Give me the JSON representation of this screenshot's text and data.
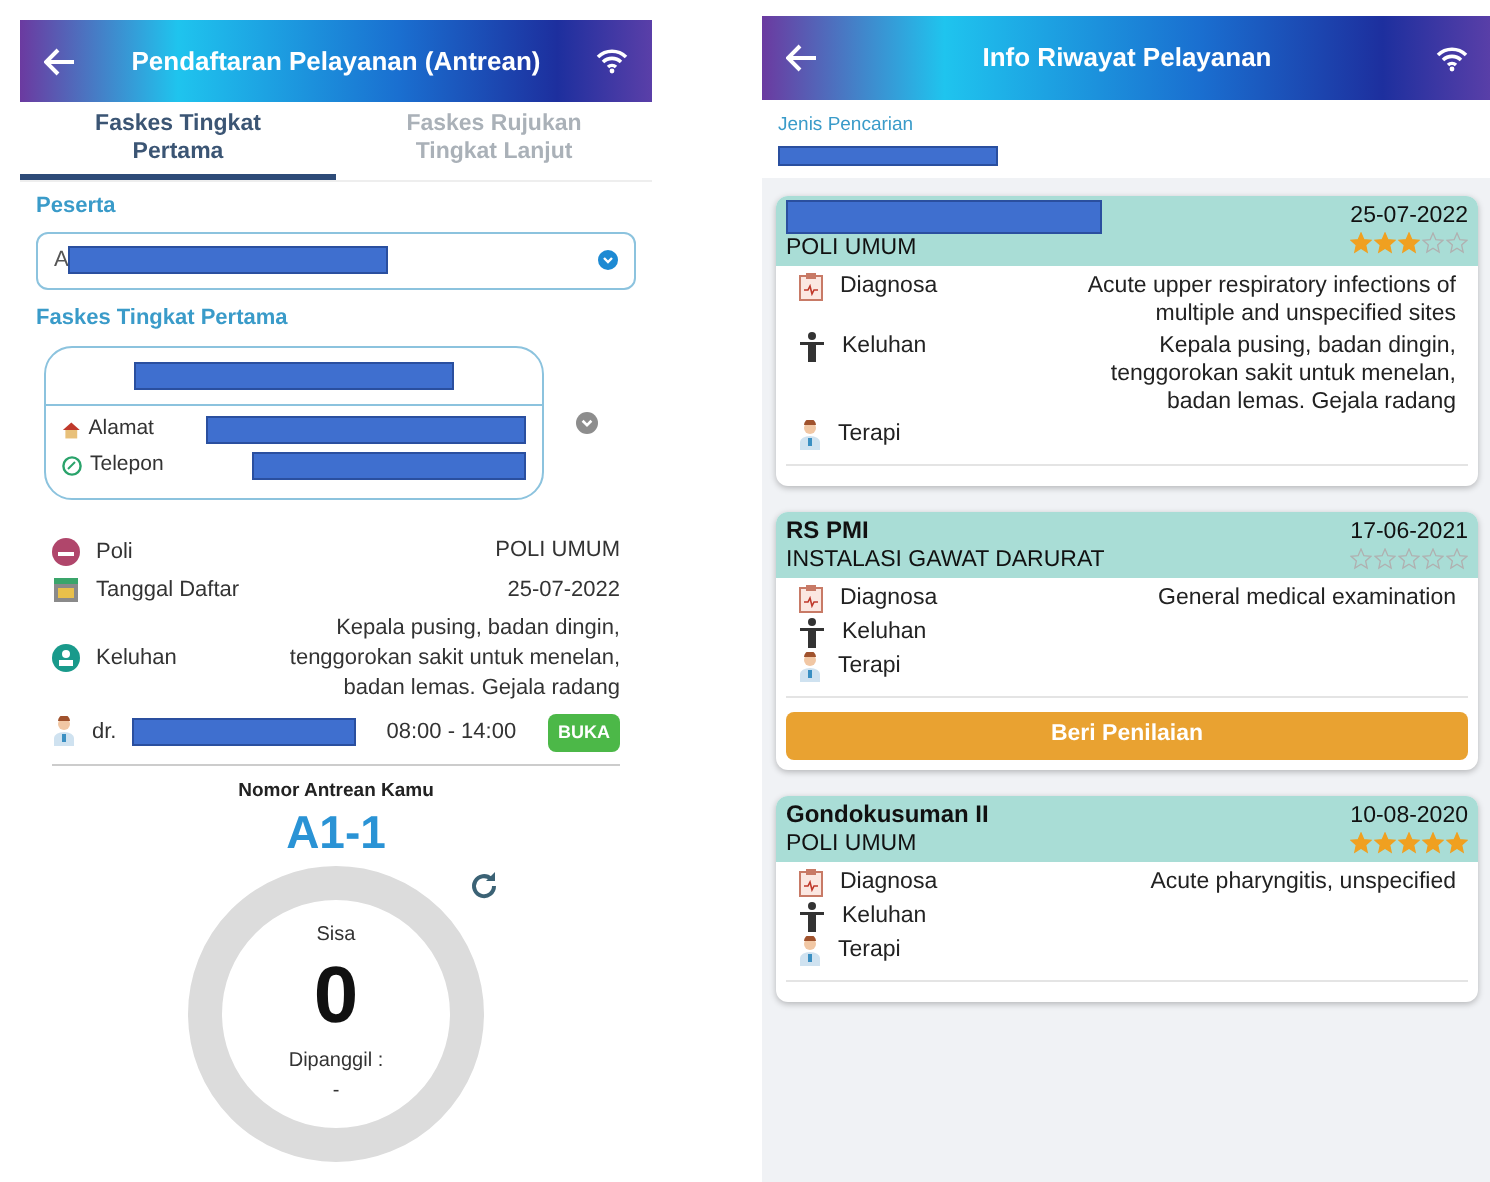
{
  "left_screen": {
    "header": {
      "title": "Pendaftaran Pelayanan (Antrean)"
    },
    "tabs": [
      {
        "label": "Faskes Tingkat Pertama",
        "selected": true
      },
      {
        "label": "Faskes Rujukan Tingkat Lanjut",
        "selected": false
      }
    ],
    "peserta": {
      "label": "Peserta",
      "value": "A"
    },
    "faskes": {
      "label": "Faskes Tingkat Pertama",
      "alamat_label": "Alamat",
      "telepon_label": "Telepon"
    },
    "details": [
      {
        "kind": "poli",
        "label": "Poli",
        "value": "POLI UMUM"
      },
      {
        "kind": "calendar",
        "label": "Tanggal Daftar",
        "value": "25-07-2022"
      },
      {
        "kind": "keluhan",
        "label": "Keluhan",
        "value": "Kepala pusing, badan dingin, tenggorokan sakit untuk menelan, badan lemas. Gejala radang"
      }
    ],
    "doctor": {
      "prefix": "dr.",
      "hours": "08:00 - 14:00",
      "status": "BUKA"
    },
    "queue": {
      "title": "Nomor Antrean Kamu",
      "number": "A1-1",
      "remaining_label": "Sisa",
      "remaining": "0",
      "called_label": "Dipanggil :",
      "called": "-"
    }
  },
  "right_screen": {
    "header": {
      "title": "Info Riwayat Pelayanan"
    },
    "search_label": "Jenis Pencarian",
    "records": [
      {
        "unit": "POLI UMUM",
        "date": "25-07-2022",
        "stars": 3,
        "rows": [
          {
            "kind": "diagnosa",
            "label": "Diagnosa",
            "value": "Acute upper respiratory infections of multiple and unspecified sites"
          },
          {
            "kind": "keluhan",
            "label": "Keluhan",
            "value": "Kepala pusing, badan dingin, tenggorokan sakit untuk menelan, badan lemas. Gejala radang"
          },
          {
            "kind": "terapi",
            "label": "Terapi"
          }
        ]
      },
      {
        "facility": "RS  PMI",
        "unit": "INSTALASI GAWAT DARURAT",
        "date": "17-06-2021",
        "stars": 0,
        "rows": [
          {
            "kind": "diagnosa",
            "label": "Diagnosa",
            "value": "General medical examination"
          },
          {
            "kind": "keluhan",
            "label": "Keluhan"
          },
          {
            "kind": "terapi",
            "label": "Terapi"
          }
        ],
        "button": "Beri Penilaian"
      },
      {
        "facility": "Gondokusuman II",
        "unit": "POLI UMUM",
        "date": "10-08-2020",
        "stars": 5,
        "rows": [
          {
            "kind": "diagnosa",
            "label": "Diagnosa",
            "value": "Acute pharyngitis, unspecified"
          },
          {
            "kind": "keluhan",
            "label": "Keluhan"
          },
          {
            "kind": "terapi",
            "label": "Terapi"
          }
        ]
      }
    ]
  }
}
